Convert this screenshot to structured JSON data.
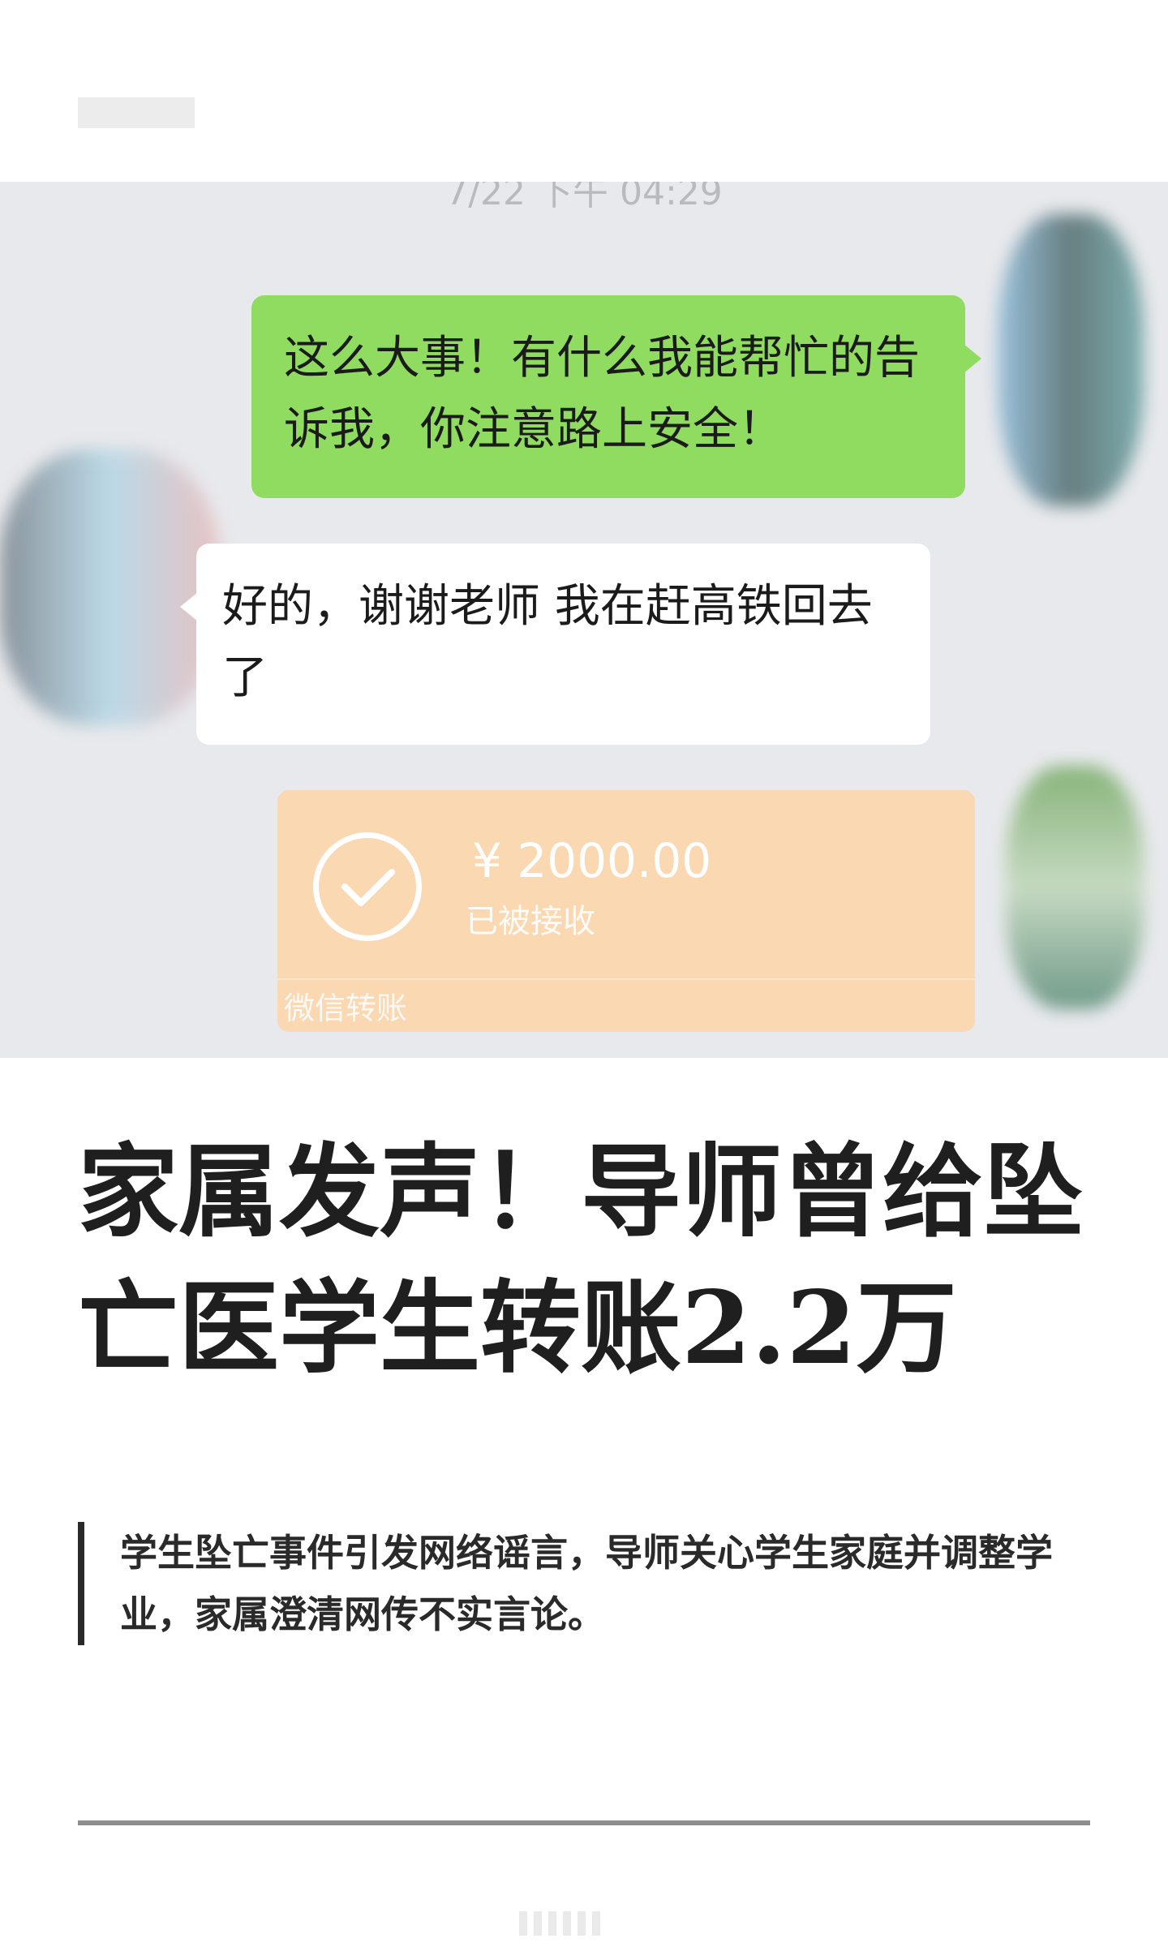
{
  "chat": {
    "timestamp": "7/22 下午 04:29",
    "outgoing_message": "这么大事！有什么我能帮忙的告诉我，你注意路上安全！",
    "incoming_message": "好的，谢谢老师 我在赶高铁回去了",
    "transfer": {
      "amount": "¥ 2000.00",
      "status": "已被接收",
      "footer": "微信转账"
    }
  },
  "article": {
    "headline": "家属发声！导师曾给坠亡医学生转账2.2万",
    "summary": "学生坠亡事件引发网络谣言，导师关心学生家庭并调整学业，家属澄清网传不实言论。"
  },
  "colors": {
    "green_bubble": "#8fdc61",
    "transfer_card": "#f9d8b2",
    "chat_background": "#e8e9ec"
  }
}
